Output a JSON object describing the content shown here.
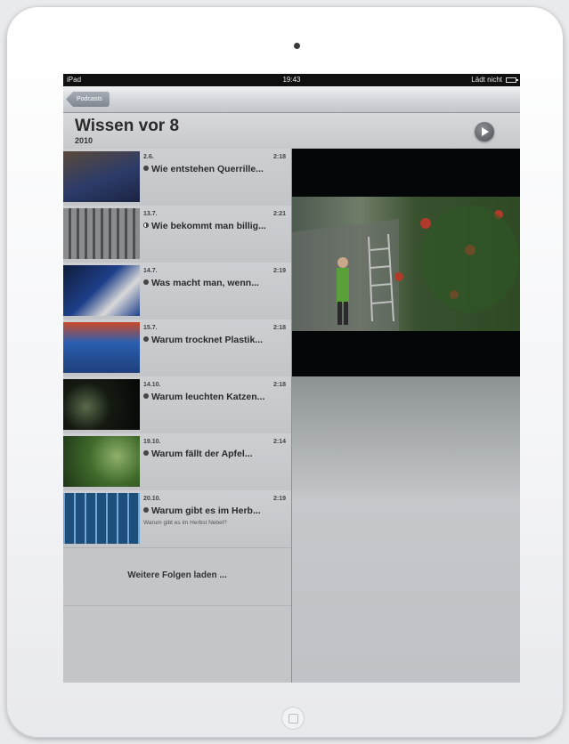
{
  "status_bar": {
    "carrier": "iPad",
    "time": "19:43",
    "charging": "Lädt nicht"
  },
  "nav": {
    "back_label": "Podcasts"
  },
  "header": {
    "title": "Wissen vor 8",
    "year": "2010"
  },
  "episodes": [
    {
      "date": "2.6.",
      "duration": "2:18",
      "title": "Wie entstehen Querrille...",
      "subtitle": "",
      "thumb_color": "#2c3b6a"
    },
    {
      "date": "13.7.",
      "duration": "2:21",
      "title": "Wie bekommt man billig...",
      "subtitle": "",
      "thumb_color": "#6b6d6f"
    },
    {
      "date": "14.7.",
      "duration": "2:19",
      "title": "Was macht man, wenn...",
      "subtitle": "",
      "thumb_color": "#1e3f8a"
    },
    {
      "date": "15.7.",
      "duration": "2:18",
      "title": "Warum trocknet Plastik...",
      "subtitle": "",
      "thumb_color": "#2b5fb0"
    },
    {
      "date": "14.10.",
      "duration": "2:18",
      "title": "Warum leuchten Katzen...",
      "subtitle": "",
      "thumb_color": "#141a12"
    },
    {
      "date": "19.10.",
      "duration": "2:14",
      "title": "Warum fällt der Apfel...",
      "subtitle": "",
      "thumb_color": "#3f6a2b"
    },
    {
      "date": "20.10.",
      "duration": "2:19",
      "title": "Warum gibt es im Herb...",
      "subtitle": "Warum gibt es im Herbst Nebel?",
      "thumb_color": "#1d4f7a"
    }
  ],
  "load_more": "Weitere Folgen laden ..."
}
